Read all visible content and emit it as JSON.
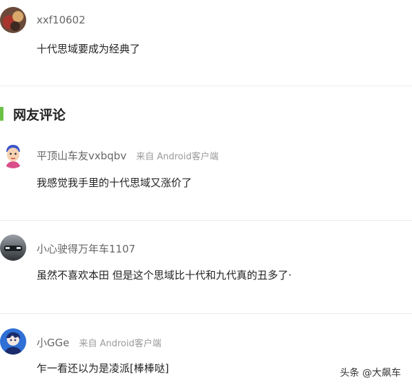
{
  "top_comment": {
    "username": "xxf10602",
    "content": "十代思域要成为经典了"
  },
  "section": {
    "title": "网友评论",
    "accent_color": "#6ac146"
  },
  "comments": [
    {
      "username": "平顶山车友vxbqbv",
      "source": "来自 Android客户端",
      "content": "我感觉我手里的十代思域又涨价了",
      "avatar_icon": "cartoon-person-avatar"
    },
    {
      "username": "小心驶得万年车1107",
      "source": "",
      "content": "虽然不喜欢本田 但是这个思域比十代和九代真的丑多了·",
      "avatar_icon": "car-photo-avatar"
    },
    {
      "username": "小GGe",
      "source": "来自 Android客户端",
      "content": "乍一看还以为是凌派[棒棒哒]",
      "avatar_icon": "anime-avatar"
    }
  ],
  "watermark": "头条 @大飙车"
}
